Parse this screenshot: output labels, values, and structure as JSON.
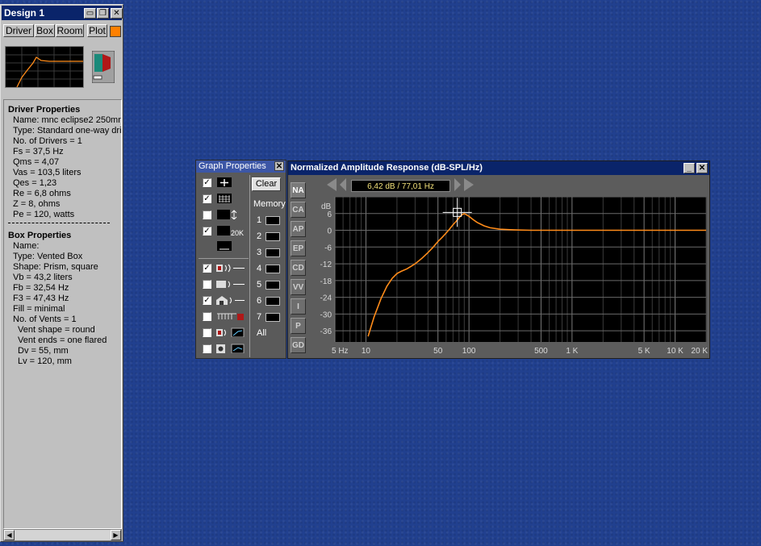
{
  "design_window": {
    "title": "Design 1",
    "tabs": [
      "Driver",
      "Box",
      "Room",
      "Plot"
    ],
    "driver_heading": "Driver Properties",
    "driver_lines": [
      "Name: mnc eclipse2 250mm",
      "Type: Standard one-way driv",
      "No. of Drivers = 1",
      "Fs =  37,5 Hz",
      "Qms =  4,07",
      "Vas =  103,5 liters",
      "Qes =  1,23",
      "Re =  6,8 ohms",
      "Z =  8, ohms",
      "Pe =  120, watts"
    ],
    "box_heading": "Box Properties",
    "box_lines": [
      "Name:",
      "Type: Vented Box",
      "Shape: Prism, square",
      "Vb =  43,2 liters",
      "Fb =  32,54 Hz",
      "F3 =  47,43 Hz",
      "Fill = minimal",
      "No. of Vents = 1"
    ],
    "vent_lines": [
      "Vent shape = round",
      "Vent ends = one flared",
      "Dv =  55, mm",
      "Lv =  120, mm"
    ]
  },
  "graph_properties": {
    "title": "Graph Properties",
    "clear_label": "Clear",
    "memory_label": "Memory",
    "memory_slots": [
      "1",
      "2",
      "3",
      "4",
      "5",
      "6",
      "7"
    ],
    "all_label": "All",
    "range_label": "20K",
    "options": [
      {
        "icon": "crosshair-icon",
        "checked": true
      },
      {
        "icon": "grid-icon",
        "checked": true
      },
      {
        "icon": "vertical-scale-icon",
        "checked": false
      },
      {
        "icon": "frequency-range-icon",
        "checked": true
      },
      {
        "icon": "line-style-icon",
        "checked": null
      },
      {
        "icon": "speaker-output-icon",
        "checked": true
      },
      {
        "icon": "box-output-icon",
        "checked": false
      },
      {
        "icon": "room-output-icon",
        "checked": true
      },
      {
        "icon": "amplifier-output-icon",
        "checked": false
      },
      {
        "icon": "speaker-chart-icon",
        "checked": false
      },
      {
        "icon": "driver-chart-icon",
        "checked": false
      }
    ]
  },
  "graph_window": {
    "title": "Normalized Amplitude Response (dB-SPL/Hz)",
    "readout": "6,42 dB / 77,01 Hz",
    "side_tabs": [
      "NA",
      "CA",
      "AP",
      "EP",
      "CD",
      "VV",
      "I",
      "P",
      "GD"
    ],
    "active_tab": "NA"
  },
  "chart_data": {
    "type": "line",
    "title": "Normalized Amplitude Response (dB-SPL/Hz)",
    "ylabel": "dB",
    "xscale": "log",
    "xlim": [
      5,
      20000
    ],
    "ylim": [
      -40,
      12
    ],
    "x_ticks": [
      5,
      10,
      50,
      100,
      500,
      1000,
      5000,
      10000,
      20000
    ],
    "x_tick_labels": [
      "5 Hz",
      "10",
      "50",
      "100",
      "500",
      "1 K",
      "5 K",
      "10 K",
      "20 K"
    ],
    "y_ticks": [
      6,
      0,
      -6,
      -12,
      -18,
      -24,
      -30,
      -36
    ],
    "grid": true,
    "line_color": "#ff8c1a",
    "cursor": {
      "x": 77.01,
      "y": 6.42
    },
    "series": [
      {
        "x": [
          10.5,
          12,
          14,
          16,
          18,
          20,
          22,
          25,
          30,
          35,
          40,
          45,
          50,
          55,
          60,
          65,
          70,
          75,
          80,
          85,
          90,
          100,
          110,
          120,
          140,
          160,
          200,
          250,
          300,
          400,
          500,
          700,
          1000,
          2000,
          5000,
          10000,
          20000
        ],
        "y": [
          -38,
          -31,
          -24.5,
          -20,
          -17.2,
          -15.5,
          -14.7,
          -13.8,
          -12,
          -10,
          -8,
          -6,
          -4,
          -2.5,
          -1,
          0.5,
          2,
          3.2,
          4.5,
          5.5,
          6,
          5,
          3.8,
          2.8,
          1.6,
          0.9,
          0.4,
          0.2,
          0.1,
          0,
          0,
          0,
          0,
          0,
          0,
          0,
          0
        ]
      }
    ]
  }
}
